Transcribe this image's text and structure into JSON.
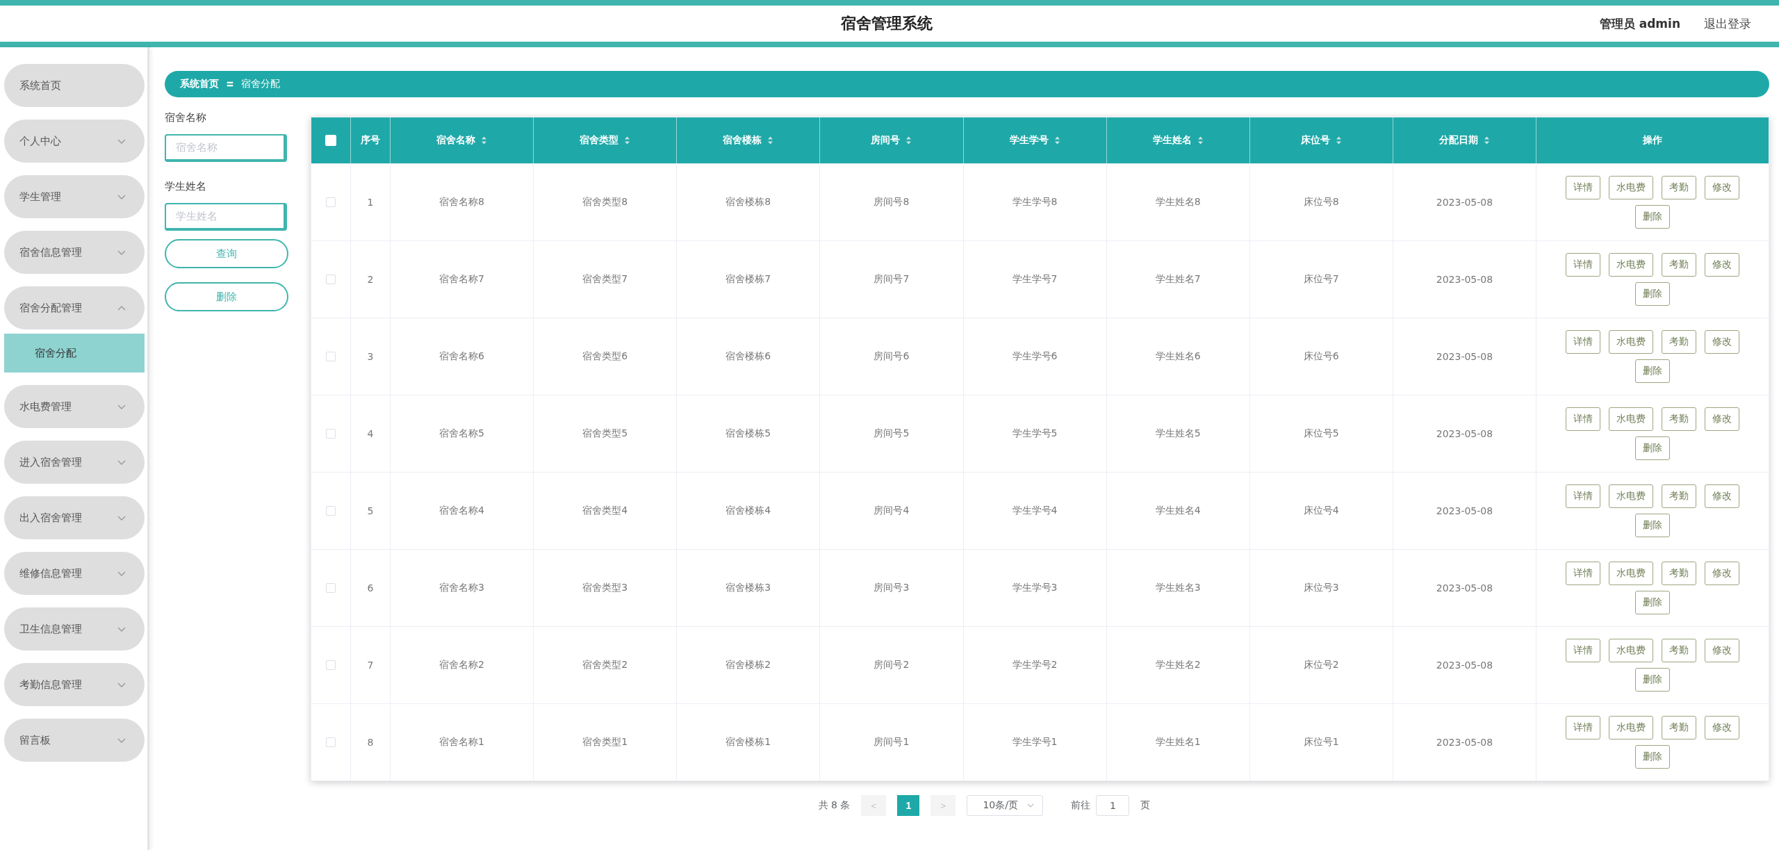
{
  "header": {
    "title": "宿舍管理系统",
    "user": "管理员 admin",
    "logout": "退出登录"
  },
  "sidebar": {
    "items": [
      {
        "label": "系统首页"
      },
      {
        "label": "个人中心",
        "expanded": false
      },
      {
        "label": "学生管理",
        "expanded": false
      },
      {
        "label": "宿舍信息管理",
        "expanded": false
      },
      {
        "label": "宿舍分配管理",
        "expanded": true,
        "children": [
          {
            "label": "宿舍分配",
            "selected": true
          }
        ]
      },
      {
        "label": "水电费管理",
        "expanded": false
      },
      {
        "label": "进入宿舍管理",
        "expanded": false
      },
      {
        "label": "出入宿舍管理",
        "expanded": false
      },
      {
        "label": "维修信息管理",
        "expanded": false
      },
      {
        "label": "卫生信息管理",
        "expanded": false
      },
      {
        "label": "考勤信息管理",
        "expanded": false
      },
      {
        "label": "留言板",
        "expanded": false
      }
    ]
  },
  "breadcrumb": {
    "items": [
      "系统首页",
      "宿舍分配"
    ],
    "separator": "〓"
  },
  "search": {
    "fields": [
      {
        "label": "宿舍名称",
        "placeholder": "宿舍名称"
      },
      {
        "label": "学生姓名",
        "placeholder": "学生姓名"
      }
    ],
    "buttons": [
      "查询",
      "删除"
    ]
  },
  "table": {
    "select_all_checked": false,
    "columns": [
      {
        "label": "序号",
        "sortable": false
      },
      {
        "label": "宿舍名称",
        "sortable": true
      },
      {
        "label": "宿舍类型",
        "sortable": true
      },
      {
        "label": "宿舍楼栋",
        "sortable": true
      },
      {
        "label": "房间号",
        "sortable": true
      },
      {
        "label": "学生学号",
        "sortable": true
      },
      {
        "label": "学生姓名",
        "sortable": true
      },
      {
        "label": "床位号",
        "sortable": true
      },
      {
        "label": "分配日期",
        "sortable": true
      },
      {
        "label": "操作",
        "sortable": false
      }
    ],
    "rows": [
      {
        "checked": false,
        "cells": [
          "1",
          "宿舍名称8",
          "宿舍类型8",
          "宿舍楼栋8",
          "房间号8",
          "学生学号8",
          "学生姓名8",
          "床位号8",
          "2023-05-08"
        ],
        "actions": [
          "详情",
          "水电费",
          "考勤",
          "修改",
          "删除"
        ]
      },
      {
        "checked": false,
        "cells": [
          "2",
          "宿舍名称7",
          "宿舍类型7",
          "宿舍楼栋7",
          "房间号7",
          "学生学号7",
          "学生姓名7",
          "床位号7",
          "2023-05-08"
        ],
        "actions": [
          "详情",
          "水电费",
          "考勤",
          "修改",
          "删除"
        ]
      },
      {
        "checked": false,
        "cells": [
          "3",
          "宿舍名称6",
          "宿舍类型6",
          "宿舍楼栋6",
          "房间号6",
          "学生学号6",
          "学生姓名6",
          "床位号6",
          "2023-05-08"
        ],
        "actions": [
          "详情",
          "水电费",
          "考勤",
          "修改",
          "删除"
        ]
      },
      {
        "checked": false,
        "cells": [
          "4",
          "宿舍名称5",
          "宿舍类型5",
          "宿舍楼栋5",
          "房间号5",
          "学生学号5",
          "学生姓名5",
          "床位号5",
          "2023-05-08"
        ],
        "actions": [
          "详情",
          "水电费",
          "考勤",
          "修改",
          "删除"
        ]
      },
      {
        "checked": false,
        "cells": [
          "5",
          "宿舍名称4",
          "宿舍类型4",
          "宿舍楼栋4",
          "房间号4",
          "学生学号4",
          "学生姓名4",
          "床位号4",
          "2023-05-08"
        ],
        "actions": [
          "详情",
          "水电费",
          "考勤",
          "修改",
          "删除"
        ]
      },
      {
        "checked": false,
        "cells": [
          "6",
          "宿舍名称3",
          "宿舍类型3",
          "宿舍楼栋3",
          "房间号3",
          "学生学号3",
          "学生姓名3",
          "床位号3",
          "2023-05-08"
        ],
        "actions": [
          "详情",
          "水电费",
          "考勤",
          "修改",
          "删除"
        ]
      },
      {
        "checked": false,
        "cells": [
          "7",
          "宿舍名称2",
          "宿舍类型2",
          "宿舍楼栋2",
          "房间号2",
          "学生学号2",
          "学生姓名2",
          "床位号2",
          "2023-05-08"
        ],
        "actions": [
          "详情",
          "水电费",
          "考勤",
          "修改",
          "删除"
        ]
      },
      {
        "checked": false,
        "cells": [
          "8",
          "宿舍名称1",
          "宿舍类型1",
          "宿舍楼栋1",
          "房间号1",
          "学生学号1",
          "学生姓名1",
          "床位号1",
          "2023-05-08"
        ],
        "actions": [
          "详情",
          "水电费",
          "考勤",
          "修改",
          "删除"
        ]
      }
    ]
  },
  "pagination": {
    "total": "共 8 条",
    "prev": "<",
    "pages": [
      {
        "label": "1",
        "selected": true
      }
    ],
    "next": ">",
    "page_size": "10条/页",
    "goto_label": "前往",
    "goto_value": "1",
    "goto_suffix": "页"
  }
}
